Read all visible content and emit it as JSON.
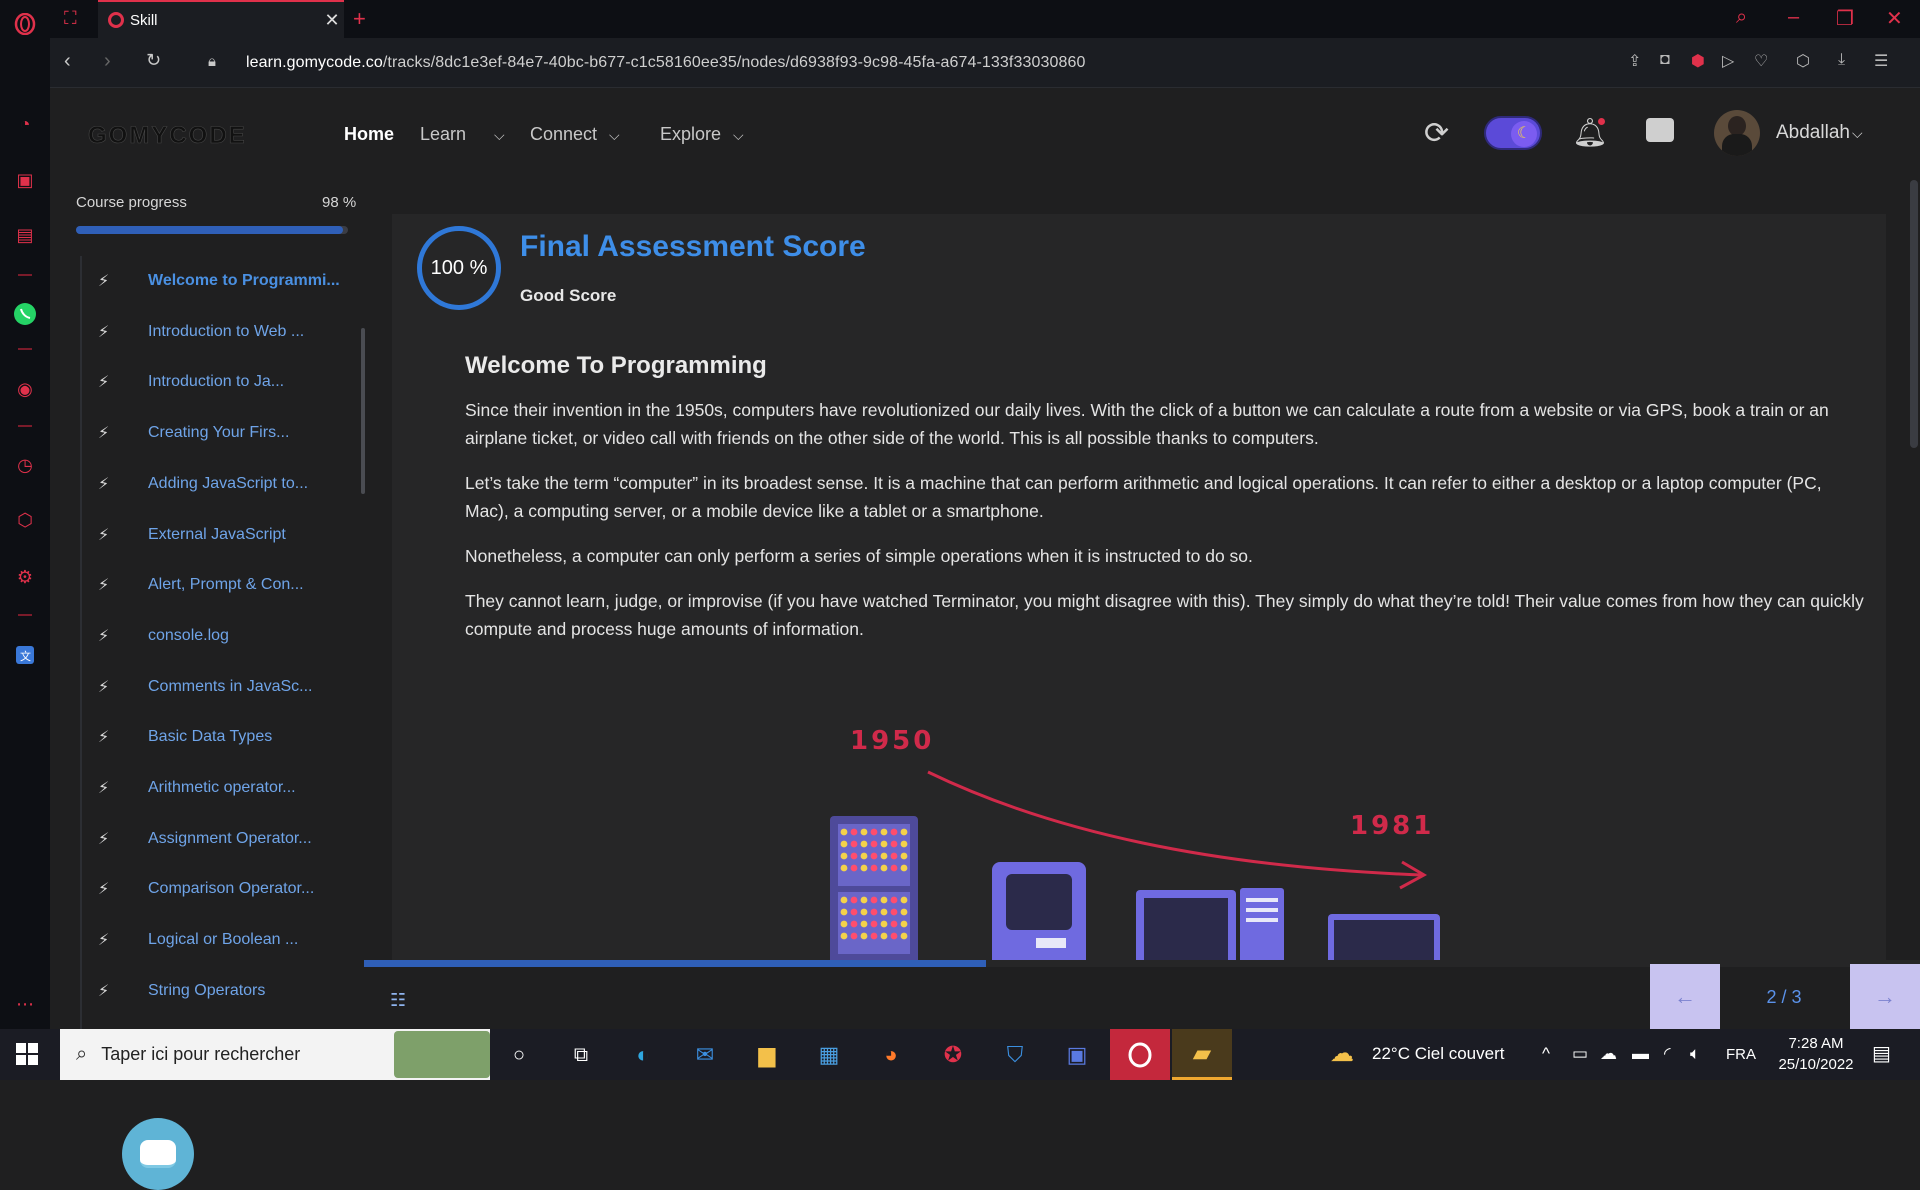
{
  "browser": {
    "tab_title": "Skill",
    "url_domain": "learn.gomycode.co",
    "url_path": "/tracks/8dc1e3ef-84e7-40bc-b677-c1c58160ee35/nodes/d6938f93-9c98-45fa-a674-133f33030860",
    "accent_color": "#e0314b"
  },
  "site_header": {
    "logo": "GOMYCODE",
    "nav": {
      "home": "Home",
      "learn": "Learn",
      "connect": "Connect",
      "explore": "Explore"
    },
    "user_name": "Abdallah",
    "dark_mode_on": true
  },
  "course": {
    "progress_label": "Course progress",
    "progress_value": "98 %",
    "progress_fraction": 0.98,
    "lessons": [
      "Welcome to Programmi...",
      "Introduction to Web ...",
      "Introduction to Ja...",
      "Creating Your Firs...",
      "Adding JavaScript to...",
      "External JavaScript",
      "Alert, Prompt & Con...",
      "console.log",
      "Comments in JavaSc...",
      "Basic Data Types",
      "Arithmetic operator...",
      "Assignment Operator...",
      "Comparison Operator...",
      "Logical or Boolean ...",
      "String Operators"
    ],
    "active_lesson_index": 0
  },
  "assessment": {
    "score": "100 %",
    "title": "Final Assessment Score",
    "subtitle": "Good Score"
  },
  "lesson": {
    "title": "Welcome To Programming",
    "paragraphs": [
      "Since their invention in the 1950s, computers have revolutionized our daily lives. With the click of a button we can calculate a route from a website or via GPS, book a train or an airplane ticket, or video call with friends on the other side of the world. This is all possible thanks to computers.",
      "Let’s take the term “computer” in its broadest sense. It is a machine that can perform arithmetic and logical operations. It can refer to either a desktop or a laptop computer (PC, Mac), a computing server, or a mobile device like a tablet or a smartphone.",
      "Nonetheless, a computer can only perform a series of simple operations when it is instructed to do so.",
      "They cannot learn, judge, or improvise (if you have watched Terminator, you might disagree with this). They simply do what they’re told! Their value comes from how they can quickly compute and process huge amounts of information."
    ],
    "illustration": {
      "year_start": "1950",
      "year_end": "1981"
    }
  },
  "pager": {
    "indicator": "2 / 3",
    "content_progress_fraction": 0.4
  },
  "taskbar": {
    "search_placeholder": "Taper ici pour rechercher",
    "weather": "22°C  Ciel couvert",
    "language": "FRA",
    "time": "7:28 AM",
    "date": "25/10/2022"
  }
}
